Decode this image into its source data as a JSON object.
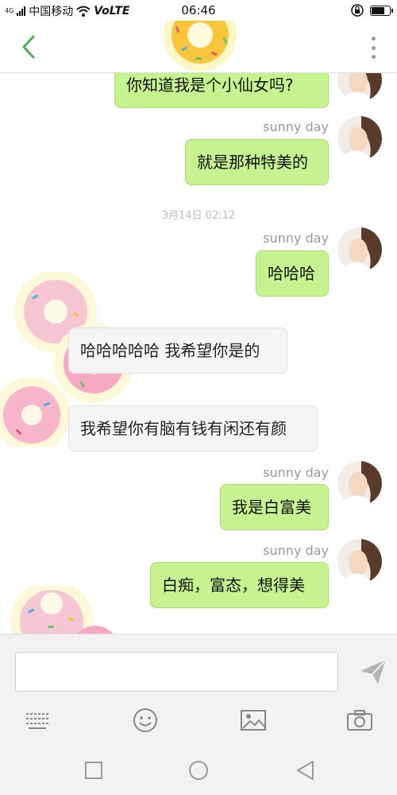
{
  "status_bar": {
    "network_type": "4G",
    "carrier": "中国移动",
    "volte": "VoLTE",
    "time": "06:46",
    "battery_level": 0.75
  },
  "header": {
    "back_icon": "chevron-left-icon",
    "menu_icon": "more-vertical-icon"
  },
  "messages": [
    {
      "side": "me",
      "text": "你知道我是个小仙女吗?"
    },
    {
      "side": "me",
      "sender": "sunny day",
      "text": "就是那种特美的"
    },
    {
      "type": "timestamp",
      "text": "3月14日 02:12"
    },
    {
      "side": "me",
      "sender": "sunny day",
      "text": "哈哈哈"
    },
    {
      "side": "peer",
      "text": "哈哈哈哈哈 我希望你是的"
    },
    {
      "side": "peer",
      "text": "我希望你有脑有钱有闲还有颜"
    },
    {
      "side": "me",
      "sender": "sunny day",
      "text": "我是白富美"
    },
    {
      "side": "me",
      "sender": "sunny day",
      "text": "白痴，富态，想得美"
    }
  ],
  "input": {
    "value": "",
    "placeholder": ""
  },
  "colors": {
    "my_bubble": "#c6f38f",
    "peer_bubble": "#f5f5f5",
    "accent": "#4caf50"
  }
}
